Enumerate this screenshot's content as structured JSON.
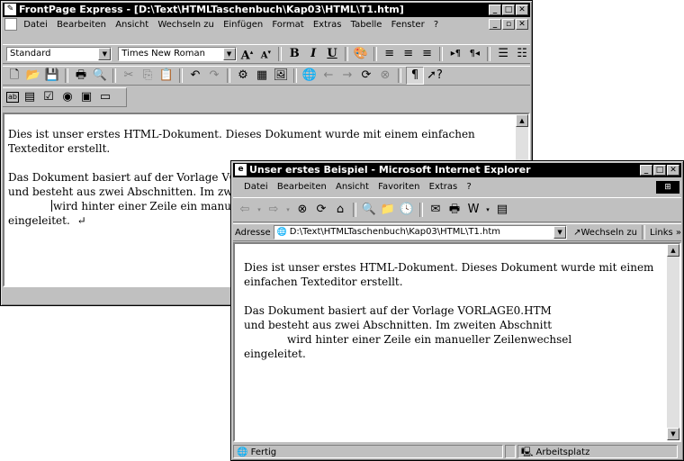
{
  "fp": {
    "title": "FrontPage Express - [D:\\Text\\HTMLTaschenbuch\\Kap03\\HTML\\T1.htm]",
    "menu": [
      "Datei",
      "Bearbeiten",
      "Ansicht",
      "Wechseln zu",
      "Einfügen",
      "Format",
      "Extras",
      "Tabelle",
      "Fenster",
      "?"
    ],
    "style_value": "Standard",
    "font_value": "Times New Roman",
    "doc": {
      "p1": "Dies ist unser erstes HTML-Dokument. Dieses Dokument wurde mit einem einfachen Texteditor erstellt.",
      "p2_line1": "Das Dokument basiert auf der Vorlage VORLAGE0.HTM",
      "p2_line2": "und besteht aus zwei Abschnitten. Im zweiten Abschnitt",
      "p2_line3": "wird hinter einer Zeile ein manueller Zeilenwechsel",
      "p2_line4": "eingeleitet.",
      "linebreak_mark": "↵"
    }
  },
  "ie": {
    "title": "Unser erstes Beispiel - Microsoft Internet Explorer",
    "menu": [
      "Datei",
      "Bearbeiten",
      "Ansicht",
      "Favoriten",
      "Extras",
      "?"
    ],
    "address_label": "Adresse",
    "address_value": "D:\\Text\\HTMLTaschenbuch\\Kap03\\HTML\\T1.htm",
    "go_label": "Wechseln zu",
    "links_label": "Links »",
    "doc": {
      "p1_line1": "Dies ist unser erstes HTML-Dokument. Dieses Dokument wurde mit einem",
      "p1_line2": "einfachen Texteditor erstellt.",
      "p2_line1": "Das Dokument basiert auf der Vorlage VORLAGE0.HTM",
      "p2_line2": "und besteht aus zwei Abschnitten. Im zweiten Abschnitt",
      "p2_line3": "wird hinter einer Zeile ein manueller Zeilenwechsel",
      "p2_line4": "eingeleitet."
    },
    "status": {
      "left": "Fertig",
      "zone": "Arbeitsplatz"
    }
  }
}
